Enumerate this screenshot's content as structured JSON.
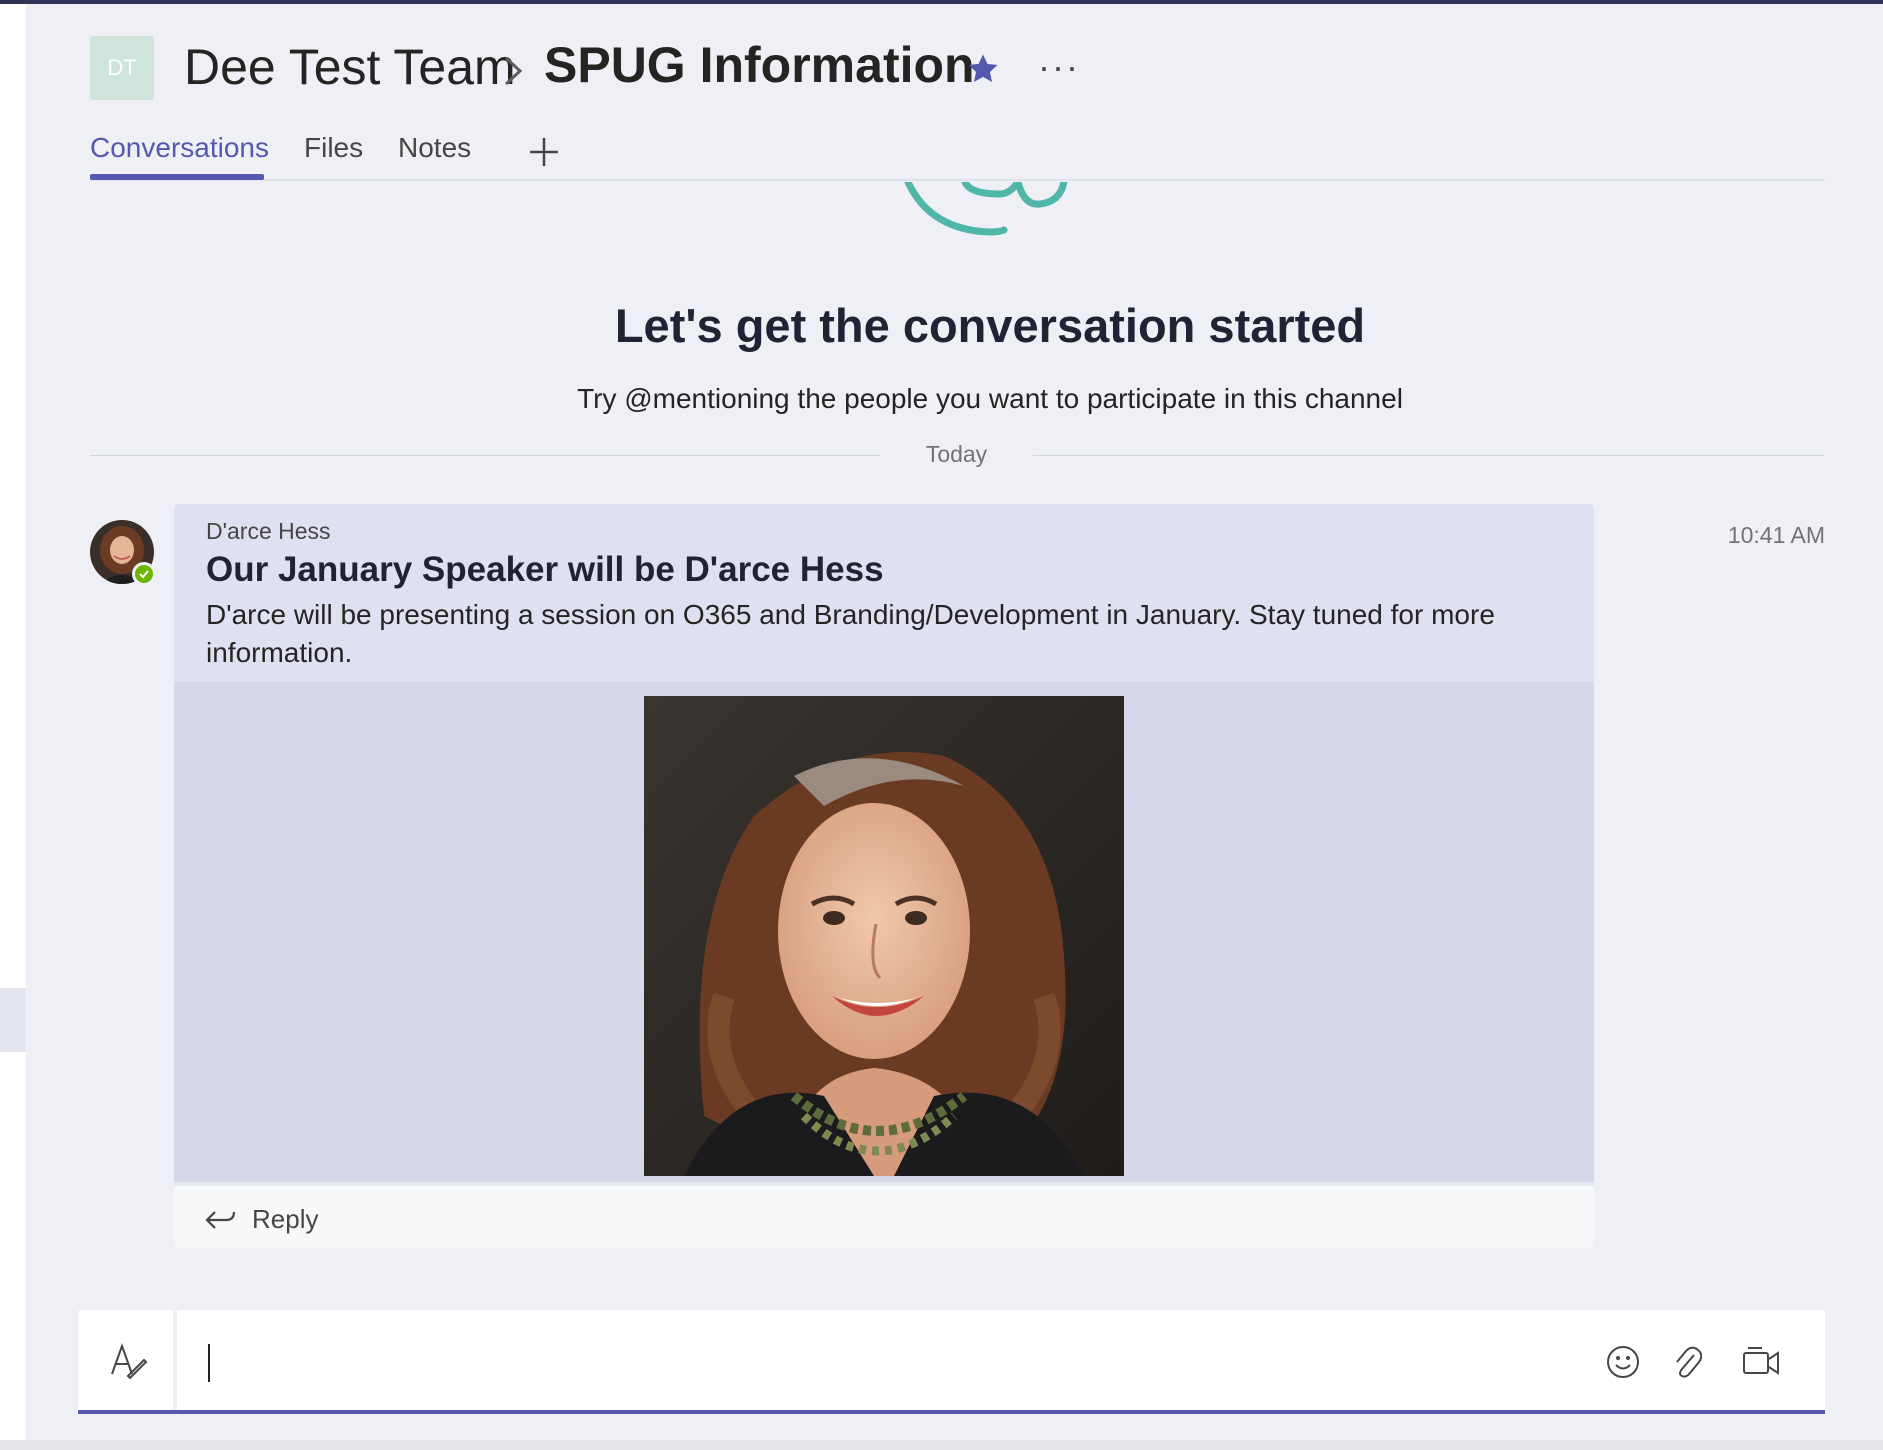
{
  "header": {
    "team_avatar_initials": "DT",
    "team_name": "Dee Test Team",
    "channel_name": "SPUG Information",
    "favorite_color": "#5558af"
  },
  "tabs": [
    {
      "label": "Conversations",
      "active": true
    },
    {
      "label": "Files",
      "active": false
    },
    {
      "label": "Notes",
      "active": false
    }
  ],
  "welcome": {
    "title": "Let's get the conversation started",
    "subtitle": "Try @mentioning the people you want to participate in this channel"
  },
  "day_divider": "Today",
  "message": {
    "author": "D'arce Hess",
    "subject": "Our January Speaker will be D'arce Hess",
    "body": "D'arce will be presenting a session on O365 and Branding/Development in January. Stay tuned for more information.",
    "time": "10:41 AM",
    "presence": "available",
    "reply_label": "Reply"
  },
  "composer": {
    "value": "",
    "placeholder": ""
  },
  "icons": [
    "chevron-right-icon",
    "star-icon",
    "more-options-icon",
    "add-tab-icon",
    "reply-icon",
    "format-icon",
    "emoji-icon",
    "attach-icon",
    "meet-now-icon",
    "presence-check-icon"
  ],
  "colors": {
    "accent": "#5558af",
    "presence_available": "#6bb700",
    "message_header_bg": "#dfe0f0",
    "page_bg": "#eef0f5"
  }
}
